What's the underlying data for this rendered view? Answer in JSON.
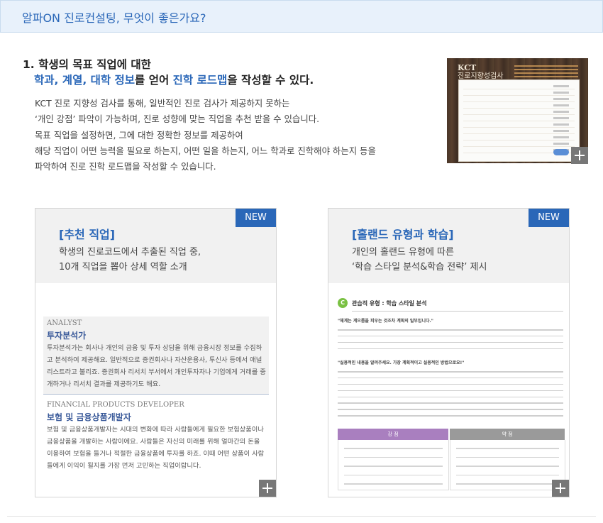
{
  "banner": {
    "title": "알파ON 진로컨설팅, 무엇이 좋은가요?"
  },
  "section1": {
    "title_line1": "1. 학생의 목표 직업에 대한",
    "title_line2_parts": [
      {
        "text": "학과, 계열, 대학 정보",
        "highlight": true
      },
      {
        "text": "를 얻어 ",
        "highlight": false
      },
      {
        "text": "진학 로드맵",
        "highlight": true
      },
      {
        "text": "을 작성할 수 있다.",
        "highlight": false
      }
    ],
    "description": [
      "KCT 진로 지향성 검사를 통해, 일반적인 진로 검사가 제공하지 못하는",
      "‘개인 강점’ 파악이 가능하며, 진로 성향에 맞는 직업을 추천 받을 수 있습니다.",
      "목표 직업을 설정하면, 그에 대한 정확한 정보를 제공하여",
      "해당 직업이 어떤 능력을 필요로 하는지, 어떤 일을 하는지, 어느 학과로 진학해야 하는지 등을",
      "파악하여 진로 진학 로드맵을 작성할 수 있습니다."
    ],
    "thumbnail": {
      "brand": "KCT",
      "title": "진로지향성검사"
    }
  },
  "cards": [
    {
      "badge": "NEW",
      "title": "[추천 직업]",
      "subtitle": [
        "학생의 진로코드에서 추출된 직업 중,",
        "10개 직업을 뽑아 상세 역할 소개"
      ],
      "jobs": [
        {
          "eng": "ANALYST",
          "ko": "투자분석가",
          "body": [
            "투자분석가는 회사나 개인의 금융 및 투자 상담을 위해 금융시장 정보를 수집하",
            "고 분석하여 제공해요. 일반적으로 증권회사나 자산운용사, 투신사 등에서 애널",
            "리스트라고 불리죠. 증권회사 리서치 부서에서 개인투자자나 기업에게 거래를 중",
            "개하거나 리서치 결과를 제공하기도 해요."
          ]
        },
        {
          "eng": "FINANCIAL PRODUCTS DEVELOPER",
          "ko": "보험 및 금융상품개발자",
          "body": [
            "보험 및 금융상품개발자는 시대의 변화에 따라 사람들에게 필요한 보험상품이나",
            "금융상품을 개발하는 사람이에요. 사람들은 자신의 미래를 위해 얼마간의 돈을",
            "이용하여 보험을 들거나 적절한 금융상품에 투자를 하죠. 이때 어떤 상품이 사람",
            "들에게 이익이 될지를 가장 먼저 고민하는 직업이랍니다."
          ]
        }
      ]
    },
    {
      "badge": "NEW",
      "title": "[홀랜드 유형과 학습]",
      "subtitle": [
        "개인의 홀랜드 유형에 따른",
        "‘학습 스타일 분석&학습 전략’ 제시"
      ],
      "doc": {
        "badge": "C",
        "title": "관습적 유형 : 학습 스타일 분석",
        "quote1": "\"체계는 계으름을 피우는 것조차 계획의 일부입니다.\"",
        "quote2": "\"실용적인 내용을 알려주세요. 가장 계획적이고 실용적인 방법으로요!\"",
        "col_left": "강 점",
        "col_right": "약 점"
      }
    }
  ]
}
